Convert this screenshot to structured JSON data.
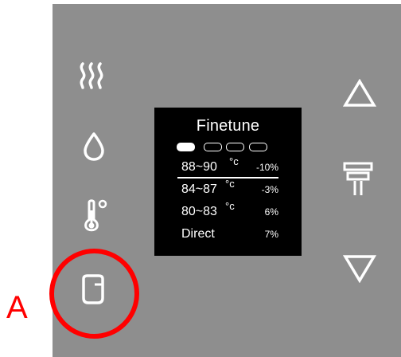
{
  "display": {
    "title": "Finetune",
    "rows": [
      {
        "temp": "88~90",
        "unit": "°c",
        "pct": "-10%"
      },
      {
        "temp": "84~87",
        "unit": "°c",
        "pct": "-3%"
      },
      {
        "temp": "80~83",
        "unit": "°c",
        "pct": "6%"
      },
      {
        "temp": "Direct",
        "unit": "",
        "pct": "7%"
      }
    ],
    "indicator_count": 4,
    "active_indicator": 1
  },
  "callout": {
    "label": "A"
  },
  "icons": [
    "steam-icon",
    "water-drop-icon",
    "thermometer-icon",
    "cup-icon",
    "up-arrow-icon",
    "dispense-icon",
    "down-arrow-icon"
  ],
  "colors": {
    "panel": "#8e8e8e",
    "icon": "#ffffff",
    "display_bg": "#000000",
    "callout": "#ff0000"
  }
}
